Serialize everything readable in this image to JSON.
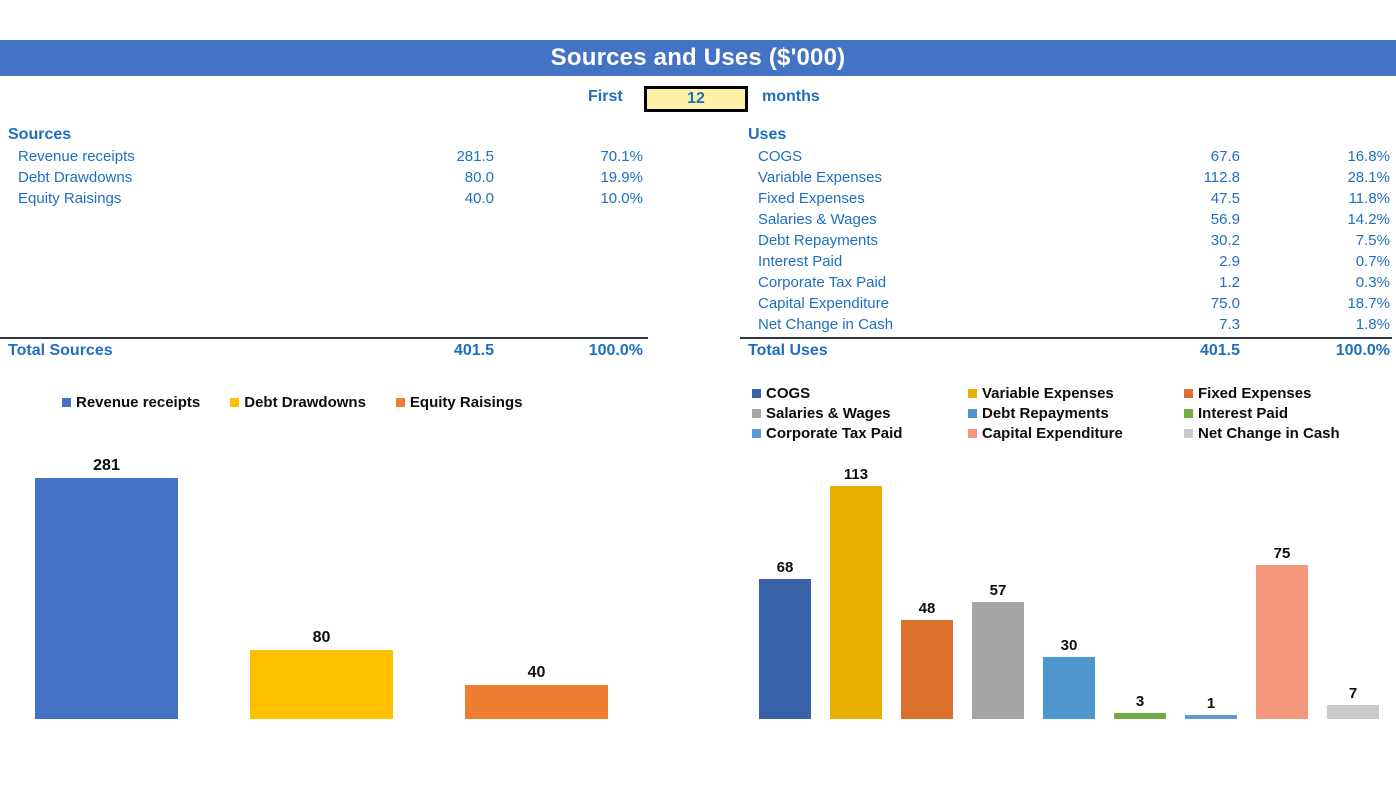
{
  "header": {
    "title": "Sources and Uses ($'000)",
    "bar_color": "#4472C4"
  },
  "period": {
    "prefix": "First",
    "value": "12",
    "suffix": "months",
    "box_color": "#FFF2A8"
  },
  "sources_table": {
    "heading": "Sources",
    "rows": [
      {
        "label": "Revenue receipts",
        "value": "281.5",
        "pct": "70.1%"
      },
      {
        "label": "Debt Drawdowns",
        "value": "80.0",
        "pct": "19.9%"
      },
      {
        "label": "Equity Raisings",
        "value": "40.0",
        "pct": "10.0%"
      }
    ],
    "total": {
      "label": "Total Sources",
      "value": "401.5",
      "pct": "100.0%"
    }
  },
  "uses_table": {
    "heading": "Uses",
    "rows": [
      {
        "label": "COGS",
        "value": "67.6",
        "pct": "16.8%"
      },
      {
        "label": "Variable Expenses",
        "value": "112.8",
        "pct": "28.1%"
      },
      {
        "label": "Fixed Expenses",
        "value": "47.5",
        "pct": "11.8%"
      },
      {
        "label": "Salaries & Wages",
        "value": "56.9",
        "pct": "14.2%"
      },
      {
        "label": "Debt Repayments",
        "value": "30.2",
        "pct": "7.5%"
      },
      {
        "label": "Interest Paid",
        "value": "2.9",
        "pct": "0.7%"
      },
      {
        "label": "Corporate Tax Paid",
        "value": "1.2",
        "pct": "0.3%"
      },
      {
        "label": "Capital Expenditure",
        "value": "75.0",
        "pct": "18.7%"
      },
      {
        "label": "Net Change in Cash",
        "value": "7.3",
        "pct": "1.8%"
      }
    ],
    "total": {
      "label": "Total Uses",
      "value": "401.5",
      "pct": "100.0%"
    }
  },
  "chart_data": [
    {
      "type": "bar",
      "title": "",
      "xlabel": "",
      "ylabel": "",
      "grid": false,
      "legend_position": "top",
      "ylim": [
        0,
        300
      ],
      "categories": [
        "Revenue receipts",
        "Debt Drawdowns",
        "Equity Raisings"
      ],
      "values": [
        281,
        80,
        40
      ],
      "labels": [
        "281",
        "80",
        "40"
      ],
      "colors": [
        "#4472C4",
        "#FFC000",
        "#ED7D31"
      ],
      "legend": [
        "Revenue receipts",
        "Debt Drawdowns",
        "Equity Raisings"
      ]
    },
    {
      "type": "bar",
      "title": "",
      "xlabel": "",
      "ylabel": "",
      "grid": false,
      "legend_position": "top",
      "ylim": [
        0,
        120
      ],
      "categories": [
        "COGS",
        "Variable Expenses",
        "Fixed Expenses",
        "Salaries & Wages",
        "Debt Repayments",
        "Interest Paid",
        "Corporate Tax Paid",
        "Capital Expenditure",
        "Net Change in Cash"
      ],
      "values": [
        68,
        113,
        48,
        57,
        30,
        3,
        1,
        75,
        7
      ],
      "labels": [
        "68",
        "113",
        "48",
        "57",
        "30",
        "3",
        "1",
        "75",
        "7"
      ],
      "colors": [
        "#3A62A8",
        "#E8B000",
        "#D9702C",
        "#A5A5A5",
        "#4E95CE",
        "#70AD47",
        "#5B9BD5",
        "#F4967C",
        "#C9C9C9"
      ],
      "legend": [
        "COGS",
        "Variable Expenses",
        "Fixed Expenses",
        "Salaries & Wages",
        "Debt Repayments",
        "Interest Paid",
        "Corporate Tax Paid",
        "Capital Expenditure",
        "Net Change in Cash"
      ]
    }
  ]
}
